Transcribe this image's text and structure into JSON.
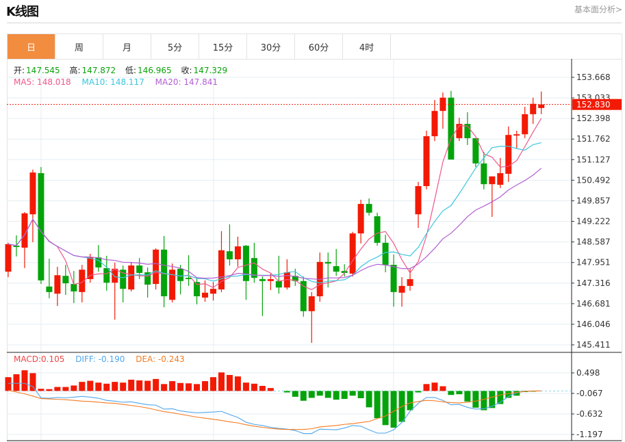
{
  "header": {
    "title": "K线图",
    "link": "基本面分析>"
  },
  "tabs": [
    {
      "label": "日",
      "active": true
    },
    {
      "label": "周"
    },
    {
      "label": "月"
    },
    {
      "label": "5分"
    },
    {
      "label": "15分"
    },
    {
      "label": "30分"
    },
    {
      "label": "60分"
    },
    {
      "label": "4时"
    }
  ],
  "ohlc_info": {
    "open_label": "开:",
    "open": "147.545",
    "high_label": "高:",
    "high": "147.872",
    "low_label": "低:",
    "low": "146.965",
    "close_label": "收:",
    "close": "147.329"
  },
  "ma_info": {
    "ma5": "MA5: 148.018",
    "ma10": "MA10: 148.117",
    "ma20": "MA20: 147.841"
  },
  "macd_info": {
    "macd": "MACD:0.105",
    "diff": "DIFF: -0.190",
    "dea": "DEA: -0.243"
  },
  "colors": {
    "up": "#f21a05",
    "down": "#05a30b",
    "ma5": "#f0568a",
    "ma10": "#3ac6dc",
    "ma20": "#b35ed2",
    "diff": "#4fa6ee",
    "dea": "#f57a1f",
    "macd_label": "#f04545",
    "current_price": "#f21a05"
  },
  "chart_data": {
    "type": "candlestick",
    "price_axis": {
      "ticks": [
        "153.668",
        "153.033",
        "152.398",
        "151.762",
        "151.127",
        "150.492",
        "149.857",
        "149.222",
        "148.587",
        "147.951",
        "147.316",
        "146.681",
        "146.046",
        "145.411"
      ],
      "range": [
        145.411,
        153.668
      ]
    },
    "current_price": "152.830",
    "candles": [
      [
        147.67,
        148.56,
        147.5,
        148.52
      ],
      [
        148.47,
        148.79,
        148.14,
        148.43
      ],
      [
        148.41,
        149.51,
        147.78,
        149.47
      ],
      [
        149.44,
        150.82,
        148.58,
        150.73
      ],
      [
        150.71,
        150.9,
        147.29,
        147.4
      ],
      [
        147.21,
        148.07,
        146.85,
        147.04
      ],
      [
        146.99,
        147.82,
        146.61,
        147.56
      ],
      [
        147.54,
        147.88,
        146.95,
        147.31
      ],
      [
        147.29,
        147.69,
        146.7,
        147.06
      ],
      [
        147.04,
        147.88,
        146.72,
        147.73
      ],
      [
        147.44,
        148.22,
        147.33,
        148.11
      ],
      [
        148.11,
        148.49,
        147.67,
        147.8
      ],
      [
        147.78,
        148.16,
        147.08,
        147.33
      ],
      [
        147.33,
        147.95,
        146.19,
        147.76
      ],
      [
        147.73,
        147.86,
        146.72,
        147.14
      ],
      [
        147.12,
        147.97,
        147.06,
        147.86
      ],
      [
        147.86,
        148.09,
        147.44,
        147.63
      ],
      [
        147.65,
        147.8,
        146.87,
        147.27
      ],
      [
        147.29,
        148.39,
        147.12,
        148.35
      ],
      [
        148.35,
        148.77,
        146.57,
        146.91
      ],
      [
        146.8,
        147.92,
        146.72,
        147.73
      ],
      [
        147.76,
        147.88,
        146.97,
        147.38
      ],
      [
        147.48,
        148.18,
        147.23,
        147.44
      ],
      [
        147.35,
        147.46,
        146.66,
        146.91
      ],
      [
        146.87,
        147.4,
        146.74,
        147.02
      ],
      [
        146.99,
        147.35,
        146.78,
        147.14
      ],
      [
        147.12,
        148.92,
        147.04,
        148.33
      ],
      [
        148.3,
        149.13,
        147.86,
        148.05
      ],
      [
        148.05,
        148.75,
        147.82,
        148.45
      ],
      [
        148.47,
        148.49,
        146.8,
        147.38
      ],
      [
        148.09,
        148.56,
        147.33,
        147.48
      ],
      [
        147.44,
        147.52,
        146.3,
        147.38
      ],
      [
        147.38,
        147.61,
        147.1,
        147.44
      ],
      [
        147.38,
        148.16,
        146.99,
        147.18
      ],
      [
        147.18,
        148.05,
        147.12,
        147.65
      ],
      [
        147.54,
        147.76,
        147.23,
        147.38
      ],
      [
        147.38,
        147.52,
        146.28,
        146.45
      ],
      [
        146.45,
        147.04,
        145.47,
        146.91
      ],
      [
        146.91,
        148.26,
        146.74,
        147.97
      ],
      [
        147.97,
        148.26,
        147.18,
        147.92
      ],
      [
        147.84,
        148.37,
        147.54,
        147.67
      ],
      [
        147.69,
        147.9,
        147.52,
        147.63
      ],
      [
        147.61,
        148.9,
        147.52,
        148.85
      ],
      [
        148.85,
        149.89,
        148.54,
        149.76
      ],
      [
        149.76,
        149.93,
        149.4,
        149.49
      ],
      [
        149.38,
        149.49,
        148.47,
        148.56
      ],
      [
        148.56,
        148.81,
        147.65,
        147.88
      ],
      [
        147.88,
        148.2,
        146.59,
        147.04
      ],
      [
        147.02,
        147.5,
        146.59,
        147.23
      ],
      [
        147.23,
        147.78,
        147.08,
        147.44
      ],
      [
        149.44,
        150.44,
        149.02,
        150.31
      ],
      [
        150.31,
        152.02,
        150.21,
        151.85
      ],
      [
        151.85,
        152.97,
        151.7,
        152.63
      ],
      [
        152.63,
        153.2,
        152.08,
        153.04
      ],
      [
        153.04,
        153.25,
        151.13,
        151.13
      ],
      [
        151.79,
        152.42,
        151.7,
        152.23
      ],
      [
        152.23,
        152.59,
        151.58,
        151.79
      ],
      [
        151.79,
        151.79,
        150.9,
        151.01
      ],
      [
        151.01,
        151.37,
        150.21,
        150.37
      ],
      [
        150.37,
        150.61,
        149.36,
        150.61
      ],
      [
        150.35,
        151.18,
        150.25,
        150.71
      ],
      [
        150.69,
        152.15,
        150.44,
        151.89
      ],
      [
        151.87,
        152.02,
        151.47,
        151.91
      ],
      [
        151.91,
        152.76,
        151.79,
        152.53
      ],
      [
        152.53,
        153.04,
        152.23,
        152.85
      ],
      [
        152.72,
        153.23,
        152.53,
        152.83
      ]
    ],
    "candle_format": [
      "open",
      "high",
      "low",
      "close"
    ],
    "ma_periods": [
      5,
      10,
      20
    ],
    "macd_axis": {
      "ticks": [
        "0.498",
        "-0.067",
        "-0.632",
        "-1.197"
      ]
    },
    "macd": [
      0.38,
      0.46,
      0.57,
      0.49,
      0.06,
      0.05,
      0.11,
      0.11,
      0.15,
      0.25,
      0.28,
      0.23,
      0.2,
      0.25,
      0.23,
      0.31,
      0.29,
      0.28,
      0.33,
      0.19,
      0.27,
      0.22,
      0.21,
      0.19,
      0.27,
      0.38,
      0.51,
      0.44,
      0.4,
      0.23,
      0.2,
      0.14,
      0.08,
      0.0,
      -0.04,
      -0.16,
      -0.27,
      -0.19,
      -0.13,
      -0.19,
      -0.24,
      -0.22,
      -0.13,
      -0.2,
      -0.45,
      -0.75,
      -0.94,
      -1.01,
      -0.85,
      -0.53,
      -0.04,
      0.19,
      0.23,
      0.13,
      -0.11,
      -0.09,
      -0.29,
      -0.46,
      -0.53,
      -0.47,
      -0.36,
      -0.19,
      -0.13,
      -0.03,
      -0.01,
      0.0
    ],
    "diff": [
      0.21,
      0.21,
      0.21,
      0.12,
      -0.19,
      -0.2,
      -0.18,
      -0.19,
      -0.17,
      -0.15,
      -0.17,
      -0.2,
      -0.26,
      -0.28,
      -0.31,
      -0.3,
      -0.34,
      -0.38,
      -0.39,
      -0.5,
      -0.49,
      -0.55,
      -0.58,
      -0.6,
      -0.59,
      -0.58,
      -0.56,
      -0.65,
      -0.73,
      -0.86,
      -0.92,
      -0.95,
      -1.0,
      -1.03,
      -1.05,
      -1.09,
      -1.17,
      -1.17,
      -1.05,
      -1.06,
      -1.07,
      -1.02,
      -0.95,
      -0.97,
      -1.07,
      -1.16,
      -1.16,
      -1.07,
      -0.87,
      -0.56,
      -0.34,
      -0.18,
      -0.18,
      -0.26,
      -0.38,
      -0.37,
      -0.45,
      -0.5,
      -0.49,
      -0.42,
      -0.31,
      -0.15,
      -0.05,
      -0.01,
      0.0,
      0.0
    ],
    "dea": [
      0.02,
      -0.03,
      -0.08,
      -0.14,
      -0.21,
      -0.22,
      -0.23,
      -0.24,
      -0.26,
      -0.28,
      -0.29,
      -0.31,
      -0.33,
      -0.34,
      -0.37,
      -0.4,
      -0.43,
      -0.47,
      -0.52,
      -0.57,
      -0.6,
      -0.64,
      -0.68,
      -0.72,
      -0.75,
      -0.78,
      -0.81,
      -0.85,
      -0.88,
      -0.93,
      -0.97,
      -1.0,
      -1.03,
      -1.05,
      -1.06,
      -1.06,
      -1.06,
      -1.04,
      -0.99,
      -0.97,
      -0.95,
      -0.92,
      -0.9,
      -0.87,
      -0.84,
      -0.76,
      -0.69,
      -0.56,
      -0.43,
      -0.33,
      -0.29,
      -0.26,
      -0.27,
      -0.3,
      -0.32,
      -0.33,
      -0.31,
      -0.28,
      -0.23,
      -0.17,
      -0.11,
      -0.07,
      -0.04,
      -0.01,
      0.0,
      0.0
    ]
  }
}
